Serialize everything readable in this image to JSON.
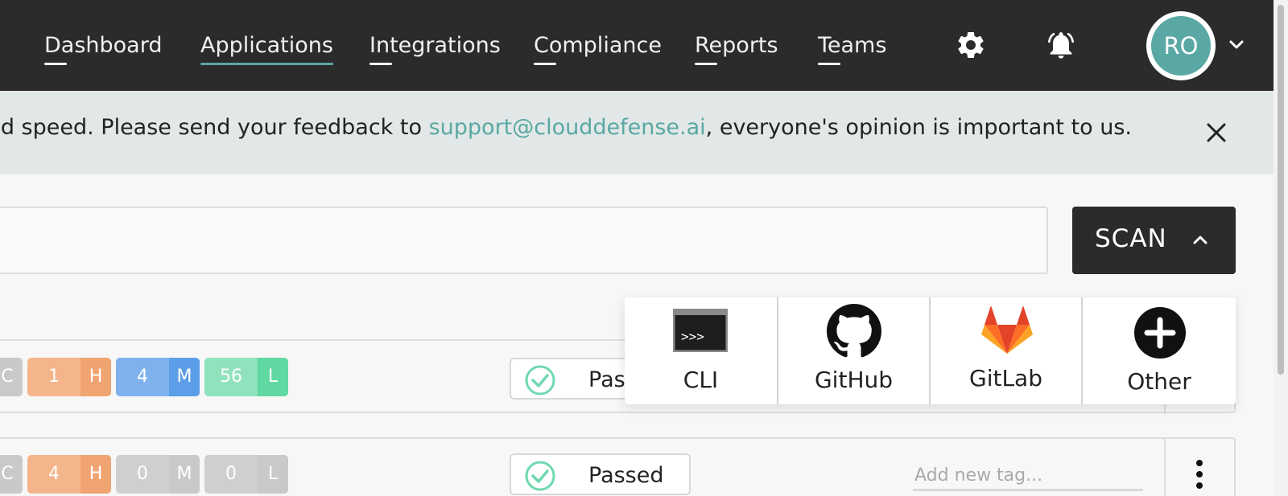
{
  "nav": {
    "items": [
      {
        "label": "Dashboard",
        "active": false
      },
      {
        "label": "Applications",
        "active": true
      },
      {
        "label": "Integrations",
        "active": false
      },
      {
        "label": "Compliance",
        "active": false
      },
      {
        "label": "Reports",
        "active": false
      },
      {
        "label": "Teams",
        "active": false
      }
    ],
    "settings_icon": "gear-icon",
    "notifications_icon": "bell-icon",
    "avatar_initials": "RO",
    "menu_icon": "chevron-down-icon"
  },
  "banner": {
    "text_before": "y and speed. Please send your feedback to ",
    "link": "support@clouddefense.ai",
    "text_after": ", everyone's opinion is important to us.",
    "close_icon": "close-icon"
  },
  "scan": {
    "label": "SCAN",
    "options": [
      {
        "label": "CLI",
        "icon": "terminal-icon"
      },
      {
        "label": "GitHub",
        "icon": "github-icon"
      },
      {
        "label": "GitLab",
        "icon": "gitlab-icon"
      },
      {
        "label": "Other",
        "icon": "plus-circle-icon"
      }
    ]
  },
  "rows": [
    {
      "severity": [
        {
          "value": "",
          "letter": "C"
        },
        {
          "value": "1",
          "letter": "H"
        },
        {
          "value": "4",
          "letter": "M"
        },
        {
          "value": "56",
          "letter": "L"
        }
      ],
      "status": "Pas"
    },
    {
      "severity": [
        {
          "value": "",
          "letter": "C"
        },
        {
          "value": "4",
          "letter": "H"
        },
        {
          "value": "0",
          "letter": "M"
        },
        {
          "value": "0",
          "letter": "L"
        }
      ],
      "status": "Passed",
      "tag_placeholder": "Add new tag..."
    }
  ],
  "colors": {
    "nav_bg": "#2b2b2b",
    "accent": "#5aa8a4",
    "banner_bg": "#e2e8e7",
    "high": "#f0a472",
    "medium": "#5d9ee8",
    "low": "#5fd8a2",
    "zero": "#c9c9c9",
    "passed": "#6fd8ae"
  }
}
